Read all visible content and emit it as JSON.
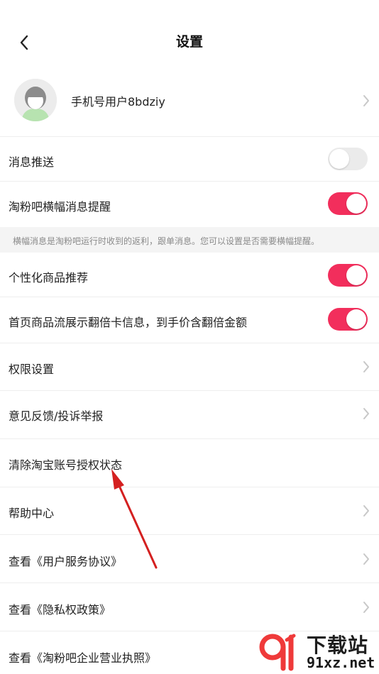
{
  "header": {
    "title": "设置"
  },
  "profile": {
    "name": "手机号用户8bdziy"
  },
  "settings": {
    "push": {
      "label": "消息推送",
      "enabled": false
    },
    "banner": {
      "label": "淘粉吧横幅消息提醒",
      "enabled": true
    },
    "banner_note": "横幅消息是淘粉吧运行时收到的返利，跟单消息。您可以设置是否需要横幅提醒。",
    "recommend": {
      "label": "个性化商品推荐",
      "enabled": true
    },
    "double_card": {
      "label": "首页商品流展示翻倍卡信息，到手价含翻倍金额",
      "enabled": true
    },
    "permissions": {
      "label": "权限设置"
    },
    "feedback": {
      "label": "意见反馈/投诉举报"
    },
    "clear_auth": {
      "label": "清除淘宝账号授权状态"
    },
    "help": {
      "label": "帮助中心"
    },
    "user_agreement": {
      "label": "查看《用户服务协议》"
    },
    "privacy": {
      "label": "查看《隐私权政策》"
    },
    "license": {
      "label": "查看《淘粉吧企业营业执照》"
    }
  },
  "watermark": {
    "top": "下载站",
    "bottom": "91xz.net"
  },
  "colors": {
    "accent": "#f22e5c",
    "annotation_arrow": "#d42020"
  }
}
